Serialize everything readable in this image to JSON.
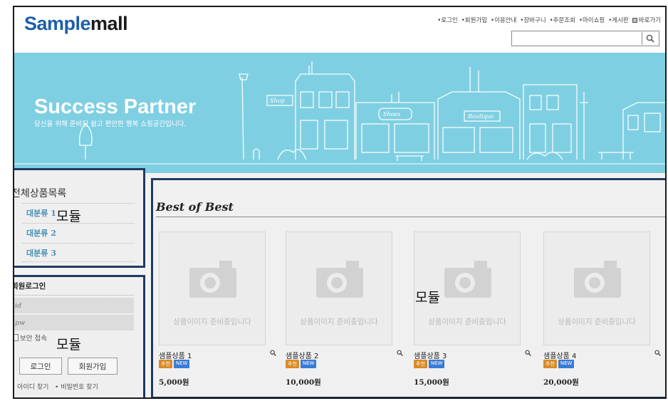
{
  "header": {
    "logo_prefix": "Sample",
    "logo_suffix": "mall",
    "nav": [
      "로그인",
      "회원가입",
      "이용안내",
      "장바구니",
      "주문조회",
      "마이쇼핑",
      "게시판",
      "바로가기"
    ],
    "search": {
      "placeholder": "",
      "icon": "search-icon"
    }
  },
  "banner": {
    "title": "Success Partner",
    "subtitle": "당신을 위해 준비된 쉽고 편안한 행복 쇼핑공간입니다.",
    "sign_texts": [
      "Shop",
      "Shoes",
      "Boutique"
    ],
    "colors": {
      "sky": "#7fcfe2",
      "line": "#ffffff"
    }
  },
  "category": {
    "title": "전체상품목록",
    "items": [
      "대분류 1",
      "대분류 2",
      "대분류 3"
    ]
  },
  "login": {
    "title": "회원로그인",
    "id_placeholder": "id",
    "pw_placeholder": "pw",
    "secure_label": "보안 접속",
    "login_button": "로그인",
    "join_button": "회원가입",
    "find_id": "아이디 찾기",
    "find_pw": "비밀번호 찾기"
  },
  "module_labels": {
    "category": "모듈",
    "products": "모듈",
    "login": "모듈"
  },
  "products": {
    "title": "Best of Best",
    "image_placeholder": "상품이미지 준비중입니다",
    "badge_rec": "추천",
    "badge_new": "NEW",
    "items": [
      {
        "name": "샘플상품 1",
        "price": "5,000원"
      },
      {
        "name": "샘플상품 2",
        "price": "10,000원"
      },
      {
        "name": "샘플상품 3",
        "price": "15,000원"
      },
      {
        "name": "샘플상품 4",
        "price": "20,000원"
      }
    ]
  },
  "colors": {
    "brand": "#1e5fa8",
    "module_border": "#1f3b63",
    "category_link": "#4a90b8"
  }
}
